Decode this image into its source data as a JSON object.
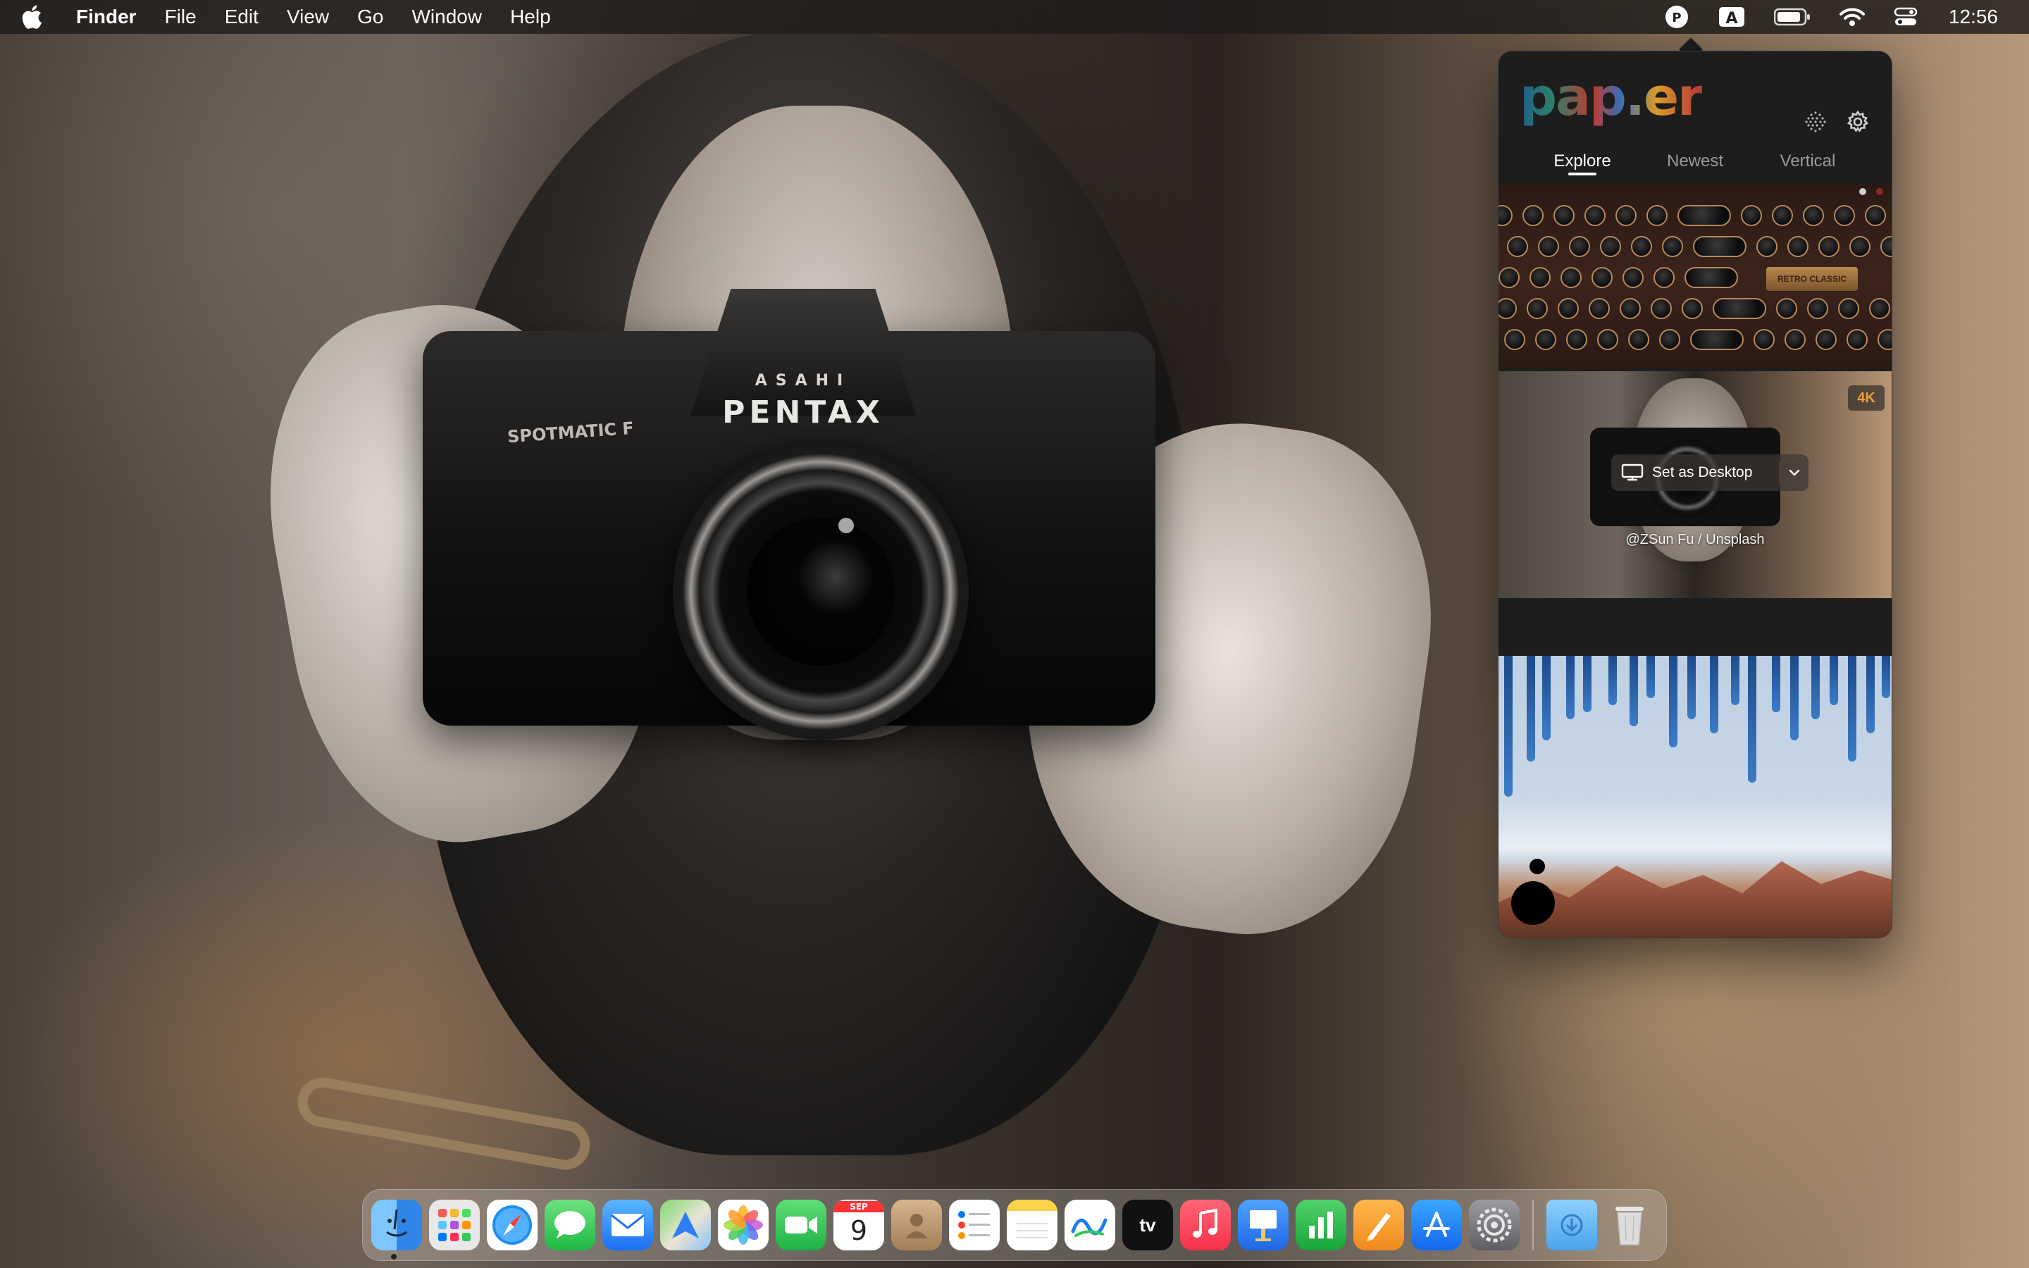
{
  "menubar": {
    "app_name": "Finder",
    "menus": [
      "File",
      "Edit",
      "View",
      "Go",
      "Window",
      "Help"
    ],
    "input_source": "A",
    "clock": "12:56"
  },
  "paper_app": {
    "logo": "pap.er",
    "tabs": [
      {
        "label": "Explore",
        "active": true
      },
      {
        "label": "Newest",
        "active": false
      },
      {
        "label": "Vertical",
        "active": false
      }
    ],
    "featured": {
      "badge": "4K",
      "action_label": "Set as Desktop",
      "credit": "@ZSun Fu / Unsplash"
    },
    "keyboard_plate_text": "RETRO CLASSIC"
  },
  "wallpaper": {
    "brand": "PENTAX",
    "brand_sub": "ASAHI",
    "model": "SPOTMATIC F"
  },
  "dock": {
    "apps": [
      {
        "name": "finder",
        "color": "#2f86e6"
      },
      {
        "name": "launchpad",
        "color": "#e8e8e8"
      },
      {
        "name": "safari",
        "color": "#ffffff"
      },
      {
        "name": "messages",
        "color": "#35c759"
      },
      {
        "name": "mail",
        "color": "#2d8cf0"
      },
      {
        "name": "maps",
        "color": "#5cc15a"
      },
      {
        "name": "photos",
        "color": "#ffffff"
      },
      {
        "name": "facetime",
        "color": "#33c153"
      },
      {
        "name": "calendar",
        "color": "#ffffff"
      },
      {
        "name": "contacts",
        "color": "#c9a57a"
      },
      {
        "name": "reminders",
        "color": "#ffffff"
      },
      {
        "name": "notes",
        "color": "#ffffff"
      },
      {
        "name": "freeform",
        "color": "#ffffff"
      },
      {
        "name": "tv",
        "color": "#111111"
      },
      {
        "name": "music",
        "color": "#fa3b55"
      },
      {
        "name": "keynote",
        "color": "#2c7cf6"
      },
      {
        "name": "numbers",
        "color": "#2fbd4f"
      },
      {
        "name": "pages",
        "color": "#f59b23"
      },
      {
        "name": "app-store",
        "color": "#2b8cf5"
      },
      {
        "name": "system-settings",
        "color": "#8e8e93"
      }
    ],
    "calendar_month": "SEP",
    "calendar_day": "9",
    "tv_label": "tv"
  }
}
